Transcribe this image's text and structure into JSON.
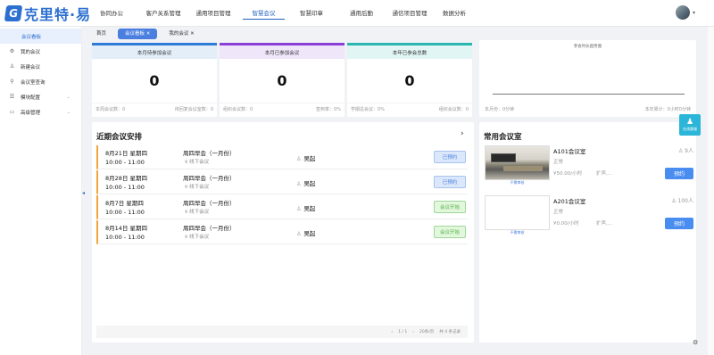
{
  "brand": {
    "logo_text": "克里特·易",
    "logo_mark": "G"
  },
  "nav": {
    "items": [
      {
        "label": "协同办公"
      },
      {
        "label": "客户关系管理"
      },
      {
        "label": "通用项目管理"
      },
      {
        "label": "智慧会议",
        "active": true
      },
      {
        "label": "智慧印章"
      },
      {
        "label": "通用后勤"
      },
      {
        "label": "通信项目管理"
      },
      {
        "label": "数据分析"
      }
    ]
  },
  "sidebar": {
    "items": [
      {
        "label": "会议看板",
        "icon": "dashboard-icon",
        "active": true
      },
      {
        "label": "我的会议",
        "icon": "gear-icon"
      },
      {
        "label": "新建会议",
        "icon": "user-icon"
      },
      {
        "label": "会议室查询",
        "icon": "search-icon"
      },
      {
        "label": "模块配置",
        "icon": "list-icon",
        "has_children": true
      },
      {
        "label": "高级管理",
        "icon": "monitor-icon",
        "has_children": true
      }
    ]
  },
  "tabs": [
    {
      "label": "首页",
      "closable": false
    },
    {
      "label": "会议看板",
      "closable": true,
      "active": true
    },
    {
      "label": "我的会议",
      "closable": true
    }
  ],
  "stats": [
    {
      "title": "本月待参加会议",
      "value": "0",
      "color": "#2d7bd6",
      "head_bg": "#e3eef9",
      "left_label": "本周会议数：",
      "left_value": "0",
      "right_label": "待回复会议室数：",
      "right_value": "0"
    },
    {
      "title": "本月已参加会议",
      "value": "0",
      "color": "#8a3fd8",
      "head_bg": "#efe6fa",
      "left_label": "组织会议数：",
      "left_value": "0",
      "right_label": "签到率：",
      "right_value": "0%"
    },
    {
      "title": "本年已参会总数",
      "value": "0",
      "color": "#2ab6b0",
      "head_bg": "#e0f5f4",
      "left_label": "学期总会议：",
      "left_value": "0%",
      "right_label": "组织会议数：",
      "right_value": "0"
    }
  ],
  "duration_chart": {
    "title": "参会时长趋势图",
    "left_label": "本月份：0分钟",
    "right_label": "本年累计：0小时0分钟"
  },
  "recent": {
    "title": "近期会议安排",
    "rows": [
      {
        "date": "8月21日 星期四",
        "time": "10:00 - 11:00",
        "title": "周四早会（一月份）",
        "location": "线下会议",
        "host": "吴起",
        "action": "已预约",
        "kind": "booked"
      },
      {
        "date": "8月28日 星期四",
        "time": "10:00 - 11:00",
        "title": "周四早会（一月份）",
        "location": "线下会议",
        "host": "吴起",
        "action": "已预约",
        "kind": "booked"
      },
      {
        "date": "8月7日 星期四",
        "time": "10:00 - 11:00",
        "title": "周四早会（一月份）",
        "location": "线下会议",
        "host": "吴起",
        "action": "会议开始",
        "kind": "start"
      },
      {
        "date": "8月14日 星期四",
        "time": "10:00 - 11:00",
        "title": "周四早会（一月份）",
        "location": "线下会议",
        "host": "吴起",
        "action": "会议开始",
        "kind": "start"
      }
    ],
    "pager": {
      "pages": "1 / 1",
      "page_size": "20条/页",
      "total": "共 4 条记录"
    }
  },
  "rooms": {
    "title": "常用会议室",
    "items": [
      {
        "name": "A101会议室",
        "status": "正常",
        "price": "¥50.00/小时",
        "ext": "扩声,...",
        "capacity": "9人",
        "button": "预约",
        "caption": "不需审核",
        "has_photo": true
      },
      {
        "name": "A201会议室",
        "status": "正常",
        "price": "¥0.00/小时",
        "ext": "扩声,...",
        "capacity": "100人",
        "button": "预约",
        "caption": "不需审核",
        "has_photo": false
      }
    ]
  },
  "help": {
    "label": "在线客服"
  }
}
